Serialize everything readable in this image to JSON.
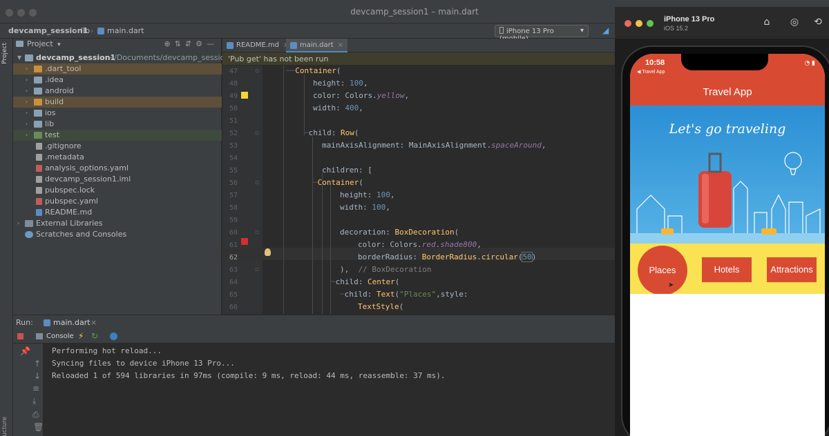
{
  "window": {
    "title": "devcamp_session1 – main.dart"
  },
  "navbar": {
    "project": "devcamp_session1",
    "folder": "lib",
    "file": "main.dart",
    "device": "iPhone 13 Pro (mobile)"
  },
  "sidebar": {
    "project_tab": "Project",
    "structure_tab": "Structure"
  },
  "project_panel": {
    "header": "Project",
    "root": {
      "name": "devcamp_session1",
      "path": "~/Documents/devcamp_session1"
    },
    "items": [
      {
        "label": ".dart_tool",
        "type": "folder"
      },
      {
        "label": ".idea",
        "type": "folder"
      },
      {
        "label": "android",
        "type": "folder"
      },
      {
        "label": "build",
        "type": "folder"
      },
      {
        "label": "ios",
        "type": "folder"
      },
      {
        "label": "lib",
        "type": "folder"
      },
      {
        "label": "test",
        "type": "folder"
      },
      {
        "label": ".gitignore",
        "type": "file"
      },
      {
        "label": ".metadata",
        "type": "file"
      },
      {
        "label": "analysis_options.yaml",
        "type": "file"
      },
      {
        "label": "devcamp_session1.iml",
        "type": "file"
      },
      {
        "label": "pubspec.lock",
        "type": "file"
      },
      {
        "label": "pubspec.yaml",
        "type": "file"
      },
      {
        "label": "README.md",
        "type": "file"
      }
    ],
    "external": "External Libraries",
    "scratches": "Scratches and Consoles"
  },
  "editor": {
    "tabs": [
      {
        "label": "README.md"
      },
      {
        "label": "main.dart"
      }
    ],
    "banner": "'Pub get' has not been run",
    "line_numbers": [
      "47",
      "48",
      "49",
      "50",
      "51",
      "52",
      "53",
      "54",
      "55",
      "56",
      "57",
      "58",
      "59",
      "60",
      "61",
      "62",
      "63",
      "64",
      "65",
      "66"
    ],
    "current_line": "62",
    "swatch_colors": {
      "yellow": "#f5d63a",
      "red": "#d32f2f"
    }
  },
  "run": {
    "label": "Run:",
    "config": "main.dart",
    "console_tab": "Console",
    "output": [
      "Performing hot reload...",
      "Syncing files to device iPhone 13 Pro...",
      "Reloaded 1 of 594 libraries in 97ms (compile: 9 ms, reload: 44 ms, reassemble: 37 ms)."
    ]
  },
  "simulator": {
    "device": "iPhone 13 Pro",
    "os": "iOS 15.2",
    "status_time": "10:58",
    "back_label": "◀ Travel App",
    "app": {
      "title": "Travel App",
      "banner_text": "Let's go traveling",
      "buttons": [
        "Places",
        "Hotels",
        "Attractions"
      ],
      "colors": {
        "appbar": "#d84b32",
        "row": "#fbe253",
        "button": "#d84b32"
      }
    }
  }
}
